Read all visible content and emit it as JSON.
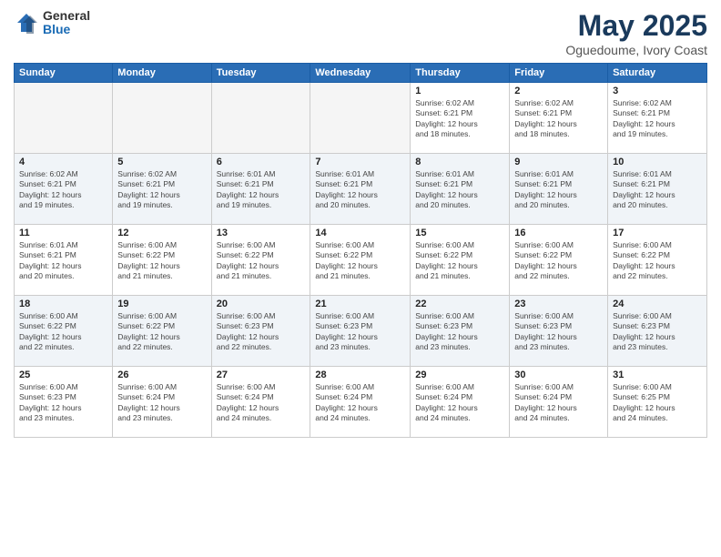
{
  "logo": {
    "general": "General",
    "blue": "Blue"
  },
  "title": "May 2025",
  "subtitle": "Oguedoume, Ivory Coast",
  "headers": [
    "Sunday",
    "Monday",
    "Tuesday",
    "Wednesday",
    "Thursday",
    "Friday",
    "Saturday"
  ],
  "weeks": [
    [
      {
        "day": "",
        "info": ""
      },
      {
        "day": "",
        "info": ""
      },
      {
        "day": "",
        "info": ""
      },
      {
        "day": "",
        "info": ""
      },
      {
        "day": "1",
        "info": "Sunrise: 6:02 AM\nSunset: 6:21 PM\nDaylight: 12 hours\nand 18 minutes."
      },
      {
        "day": "2",
        "info": "Sunrise: 6:02 AM\nSunset: 6:21 PM\nDaylight: 12 hours\nand 18 minutes."
      },
      {
        "day": "3",
        "info": "Sunrise: 6:02 AM\nSunset: 6:21 PM\nDaylight: 12 hours\nand 19 minutes."
      }
    ],
    [
      {
        "day": "4",
        "info": "Sunrise: 6:02 AM\nSunset: 6:21 PM\nDaylight: 12 hours\nand 19 minutes."
      },
      {
        "day": "5",
        "info": "Sunrise: 6:02 AM\nSunset: 6:21 PM\nDaylight: 12 hours\nand 19 minutes."
      },
      {
        "day": "6",
        "info": "Sunrise: 6:01 AM\nSunset: 6:21 PM\nDaylight: 12 hours\nand 19 minutes."
      },
      {
        "day": "7",
        "info": "Sunrise: 6:01 AM\nSunset: 6:21 PM\nDaylight: 12 hours\nand 20 minutes."
      },
      {
        "day": "8",
        "info": "Sunrise: 6:01 AM\nSunset: 6:21 PM\nDaylight: 12 hours\nand 20 minutes."
      },
      {
        "day": "9",
        "info": "Sunrise: 6:01 AM\nSunset: 6:21 PM\nDaylight: 12 hours\nand 20 minutes."
      },
      {
        "day": "10",
        "info": "Sunrise: 6:01 AM\nSunset: 6:21 PM\nDaylight: 12 hours\nand 20 minutes."
      }
    ],
    [
      {
        "day": "11",
        "info": "Sunrise: 6:01 AM\nSunset: 6:21 PM\nDaylight: 12 hours\nand 20 minutes."
      },
      {
        "day": "12",
        "info": "Sunrise: 6:00 AM\nSunset: 6:22 PM\nDaylight: 12 hours\nand 21 minutes."
      },
      {
        "day": "13",
        "info": "Sunrise: 6:00 AM\nSunset: 6:22 PM\nDaylight: 12 hours\nand 21 minutes."
      },
      {
        "day": "14",
        "info": "Sunrise: 6:00 AM\nSunset: 6:22 PM\nDaylight: 12 hours\nand 21 minutes."
      },
      {
        "day": "15",
        "info": "Sunrise: 6:00 AM\nSunset: 6:22 PM\nDaylight: 12 hours\nand 21 minutes."
      },
      {
        "day": "16",
        "info": "Sunrise: 6:00 AM\nSunset: 6:22 PM\nDaylight: 12 hours\nand 22 minutes."
      },
      {
        "day": "17",
        "info": "Sunrise: 6:00 AM\nSunset: 6:22 PM\nDaylight: 12 hours\nand 22 minutes."
      }
    ],
    [
      {
        "day": "18",
        "info": "Sunrise: 6:00 AM\nSunset: 6:22 PM\nDaylight: 12 hours\nand 22 minutes."
      },
      {
        "day": "19",
        "info": "Sunrise: 6:00 AM\nSunset: 6:22 PM\nDaylight: 12 hours\nand 22 minutes."
      },
      {
        "day": "20",
        "info": "Sunrise: 6:00 AM\nSunset: 6:23 PM\nDaylight: 12 hours\nand 22 minutes."
      },
      {
        "day": "21",
        "info": "Sunrise: 6:00 AM\nSunset: 6:23 PM\nDaylight: 12 hours\nand 23 minutes."
      },
      {
        "day": "22",
        "info": "Sunrise: 6:00 AM\nSunset: 6:23 PM\nDaylight: 12 hours\nand 23 minutes."
      },
      {
        "day": "23",
        "info": "Sunrise: 6:00 AM\nSunset: 6:23 PM\nDaylight: 12 hours\nand 23 minutes."
      },
      {
        "day": "24",
        "info": "Sunrise: 6:00 AM\nSunset: 6:23 PM\nDaylight: 12 hours\nand 23 minutes."
      }
    ],
    [
      {
        "day": "25",
        "info": "Sunrise: 6:00 AM\nSunset: 6:23 PM\nDaylight: 12 hours\nand 23 minutes."
      },
      {
        "day": "26",
        "info": "Sunrise: 6:00 AM\nSunset: 6:24 PM\nDaylight: 12 hours\nand 23 minutes."
      },
      {
        "day": "27",
        "info": "Sunrise: 6:00 AM\nSunset: 6:24 PM\nDaylight: 12 hours\nand 24 minutes."
      },
      {
        "day": "28",
        "info": "Sunrise: 6:00 AM\nSunset: 6:24 PM\nDaylight: 12 hours\nand 24 minutes."
      },
      {
        "day": "29",
        "info": "Sunrise: 6:00 AM\nSunset: 6:24 PM\nDaylight: 12 hours\nand 24 minutes."
      },
      {
        "day": "30",
        "info": "Sunrise: 6:00 AM\nSunset: 6:24 PM\nDaylight: 12 hours\nand 24 minutes."
      },
      {
        "day": "31",
        "info": "Sunrise: 6:00 AM\nSunset: 6:25 PM\nDaylight: 12 hours\nand 24 minutes."
      }
    ]
  ]
}
